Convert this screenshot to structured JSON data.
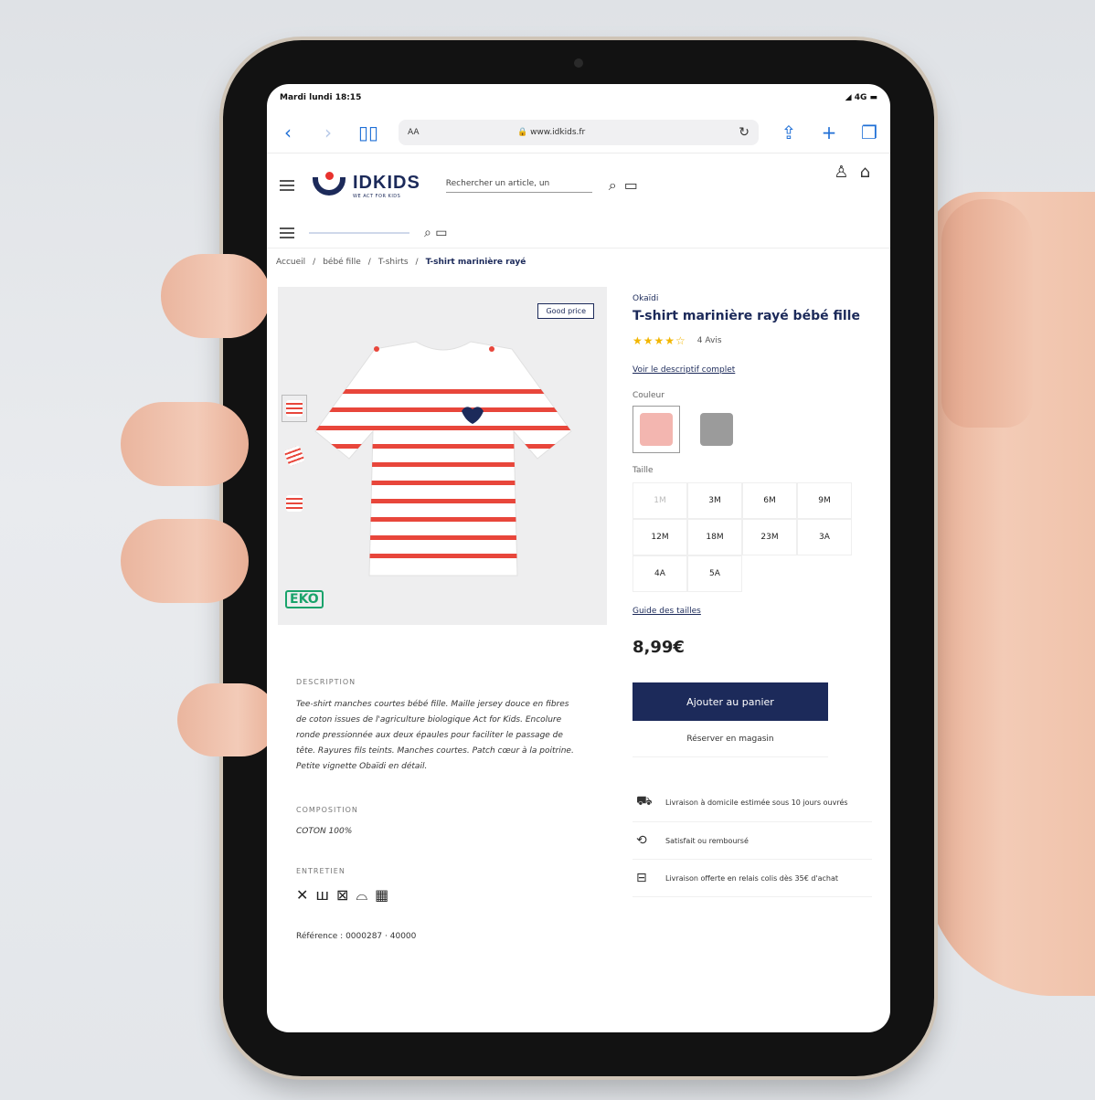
{
  "status_bar": {
    "time": "Mardi ​​lundi 18:15",
    "signal": "◢ 4G ▬"
  },
  "browser": {
    "aa_label": "AA",
    "url": "🔒 www.idkids.fr"
  },
  "header": {
    "logo_text": "IDKIDS",
    "logo_sub": "WE ACT FOR KIDS",
    "search_placeholder": "Rechercher un article, un"
  },
  "breadcrumb": [
    "Accueil",
    "bébé fille",
    "T-shirts",
    "T-shirt marinière rayé"
  ],
  "gallery": {
    "badge": "Good price",
    "eko": "EKO"
  },
  "product": {
    "brand": "Okaïdi",
    "title": "T-shirt marinière rayé bébé fille",
    "stars": "★★★★☆",
    "avis": "4 Avis",
    "full_desc_link": "Voir le descriptif complet",
    "color_label": "Couleur",
    "colors": [
      "#f3b6b0",
      "#9b9b9b"
    ],
    "size_label": "Taille",
    "sizes": [
      "1M",
      "3M",
      "6M",
      "9M",
      "12M",
      "18M",
      "23M",
      "3A",
      "4A",
      "5A"
    ],
    "size_guide": "Guide des tailles",
    "price": "8,99€",
    "cart_label": "Ajouter au panier",
    "reserve_label": "Réserver en magasin",
    "services": [
      "Livraison à domicile estimée sous 10 jours ouvrés",
      "Satisfait ou remboursé",
      "Livraison offerte en relais colis dès 35€ d'achat"
    ]
  },
  "description": {
    "label": "DESCRIPTION",
    "text": "Tee-shirt manches courtes bébé fille. Maille jersey douce en fibres de coton issues de l'agriculture biologique Act for Kids. Encolure ronde pressionnée aux deux épaules pour faciliter le passage de tête. Rayures fils teints. Manches courtes. Patch cœur à la poitrine. Petite vignette Obaïdi en détail.",
    "composition_label": "COMPOSITION",
    "composition_value": "COTON 100%",
    "care_label": "ENTRETIEN",
    "care_icons": [
      "✕",
      "ш",
      "⊠",
      "⌓",
      "▦"
    ],
    "reference": "Référence : 0000287 · 40000"
  }
}
